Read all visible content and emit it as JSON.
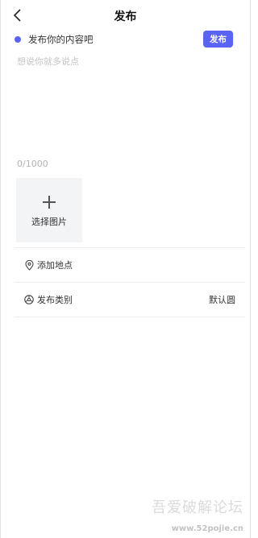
{
  "header": {
    "title": "发布",
    "back_icon": "chevron-left-icon"
  },
  "prompt": {
    "text": "发布你的内容吧",
    "dot_color": "#5b63f5",
    "publish_label": "发布"
  },
  "editor": {
    "placeholder": "想说你就多说点",
    "value": "",
    "char_count": "0/1000"
  },
  "image_picker": {
    "icon": "plus-icon",
    "label": "选择图片"
  },
  "options": [
    {
      "icon": "location-pin-icon",
      "label": "添加地点",
      "value": ""
    },
    {
      "icon": "category-icon",
      "label": "发布类别",
      "value": "默认圆"
    }
  ],
  "watermark": {
    "main": "吾爱破解论坛",
    "sub": "www.52pojie.cn"
  },
  "accent_color": "#5b63f5"
}
